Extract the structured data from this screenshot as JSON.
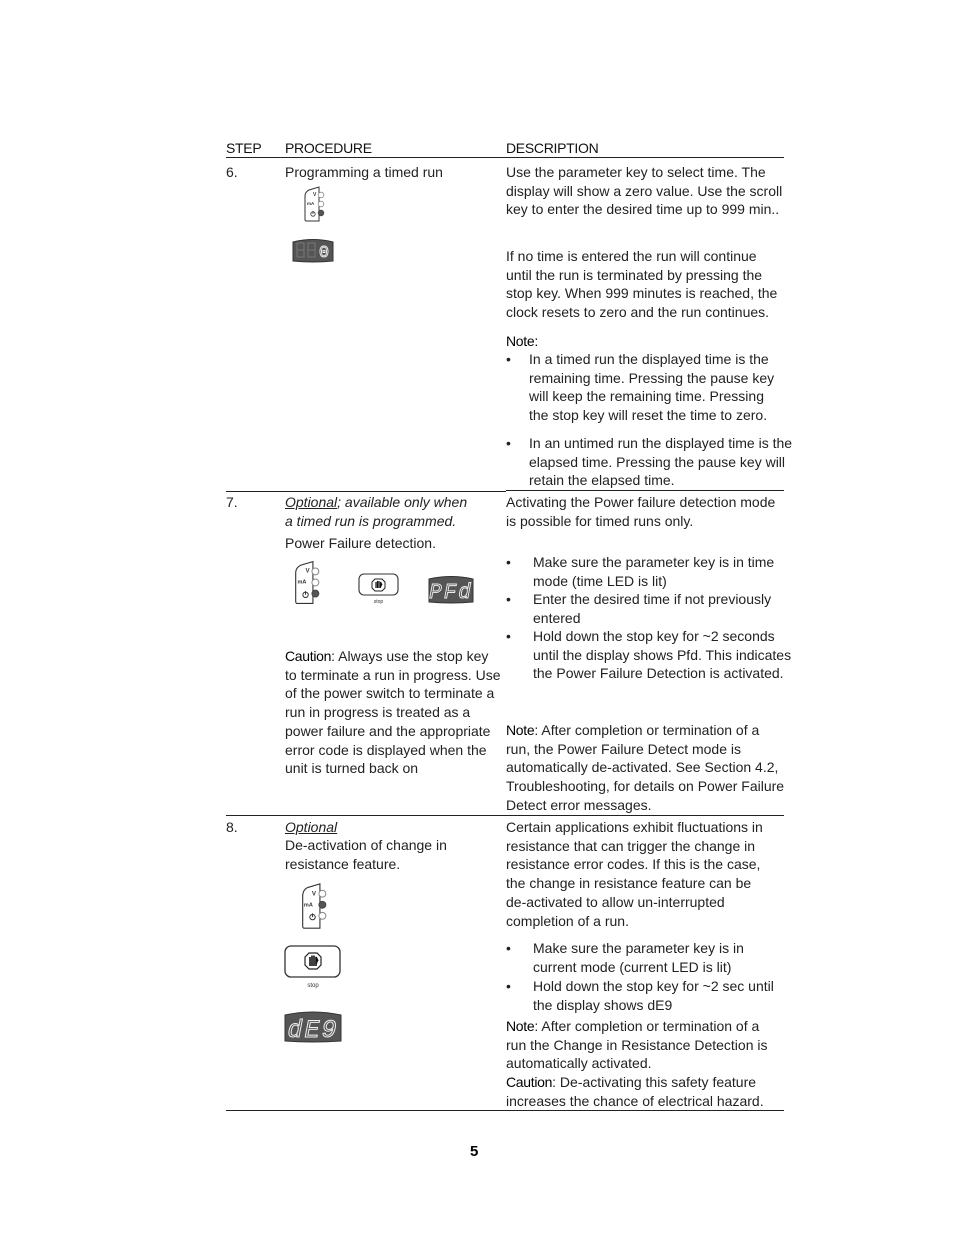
{
  "header": {
    "step": "STEP",
    "procedure": "PROCEDURE",
    "description": "DESCRIPTION"
  },
  "steps": [
    {
      "number": "6.",
      "procedure": {
        "title": "Programming a timed run",
        "led_panel": {
          "labels": [
            "V",
            "mA",
            "time-icon"
          ],
          "lit": "time"
        },
        "display": "0"
      },
      "description": {
        "para1": [
          "Use the parameter key to select time. The",
          "display will show a zero value. Use the scroll",
          "key to enter the desired time up to 999 min.."
        ],
        "para2": [
          "If no time is entered the run will continue",
          "until the run is terminated by pressing the",
          "stop key. When 999 minutes is reached, the",
          "clock resets to zero and the run continues."
        ],
        "note_label": "Note:",
        "bullets": [
          [
            "In a timed run the displayed time is the",
            "remaining time. Pressing the pause key",
            "will keep the remaining time. Pressing",
            "the stop key will reset the time to zero."
          ],
          [
            "In an untimed run the displayed time is the",
            "elapsed time. Pressing the pause key will",
            "retain the elapsed time."
          ]
        ]
      }
    },
    {
      "number": "7.",
      "procedure": {
        "optional_label": "Optional",
        "optional_rest": "; available only when",
        "optional_line2": "a timed run is programmed.",
        "title": "Power Failure detection.",
        "led_panel": {
          "labels": [
            "V",
            "mA",
            "time-icon"
          ],
          "lit": "time"
        },
        "stop_key_label": "stop",
        "display": "PFd",
        "caution_label": "Caution",
        "caution_lines": [
          ": Always use the stop key",
          "to terminate a run in progress. Use",
          "of the power switch to terminate a",
          "run in progress is treated as a",
          "power failure and the appropriate",
          "error code is displayed when the",
          "unit is turned back on"
        ]
      },
      "description": {
        "para1": [
          "Activating the Power failure detection mode",
          "is possible for timed runs only."
        ],
        "bullets": [
          [
            "Make sure the parameter key is in time",
            "mode (time LED is lit)"
          ],
          [
            "Enter the desired time if not previously",
            "entered"
          ],
          [
            "Hold down the stop key for ~2 seconds",
            "until the display shows Pfd. This indicates",
            "the Power Failure Detection is activated."
          ]
        ],
        "note_label": "Note",
        "note_lines": [
          ":  After completion or termination of a",
          "run, the Power Failure Detect mode is",
          "automatically de-activated. See Section 4.2,",
          "Troubleshooting, for details on Power Failure",
          "Detect error messages."
        ]
      }
    },
    {
      "number": "8.",
      "procedure": {
        "optional_label": "Optional",
        "title_lines": [
          "De-activation of change in",
          "resistance feature."
        ],
        "led_panel": {
          "labels": [
            "V",
            "mA",
            "time-icon"
          ],
          "lit": "mA"
        },
        "stop_key_label": "stop",
        "display": "dE9"
      },
      "description": {
        "para1": [
          "Certain applications exhibit fluctuations in",
          "resistance that can trigger the change in",
          "resistance error codes. If this is the case,",
          "the change in resistance feature can be",
          "de-activated to allow un-interrupted",
          "completion of a run."
        ],
        "bullets": [
          [
            "Make sure the parameter key is in",
            "current mode (current LED is lit)"
          ],
          [
            "Hold down the stop key for ~2 sec until",
            "the display shows dE9"
          ]
        ],
        "note_label": "Note",
        "note_lines": [
          ":  After completion or termination of a",
          "run the Change in Resistance Detection is",
          "automatically activated."
        ],
        "caution_label": "Caution",
        "caution_lines": [
          ":  De-activating this safety feature",
          "increases the chance of electrical hazard."
        ]
      }
    }
  ],
  "bullet_glyph": "•",
  "page_number": "5"
}
